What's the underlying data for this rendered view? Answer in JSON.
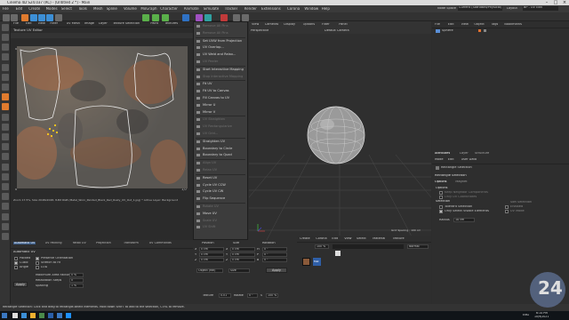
{
  "window": {
    "title": "Cinema 4D S24.037 (RC) - [Untitled 2 *] - Main",
    "layout_label": "Node Space",
    "layout_value": "Current (Standard/Physical)",
    "layout2_label": "Layout",
    "layout2_value": "BP - UV Edit"
  },
  "menubar": [
    "File",
    "Edit",
    "Create",
    "Modes",
    "Select",
    "Tools",
    "Mesh",
    "Spline",
    "Volume",
    "MoGraph",
    "Character",
    "Animate",
    "Simulate",
    "Tracker",
    "Render",
    "Extensions",
    "Corona",
    "Window",
    "Help"
  ],
  "texture_view": {
    "menus": [
      "File",
      "Edit",
      "View",
      "Filter",
      "UV Mesh",
      "Image",
      "Layer",
      "Texture Selection",
      "Paint",
      "Textures"
    ],
    "title": "Texture UV Editor",
    "status": "Zoom 17.5%, Size 2048x2048, 8-Bit RGB (Metal_Worn_Painted_Black_Red_Rusty_UV_Out_1.jpg) * Active Layer: Background",
    "axis_top_left": "0,0",
    "axis_bottom_left": "0",
    "axis_bottom_right": "1,0"
  },
  "context_menu": {
    "items": [
      {
        "label": "Remove All Pins",
        "enabled": false
      },
      {
        "label": "Remove All Pins",
        "enabled": false
      },
      {
        "label": "Set UVW from Projection",
        "enabled": true
      },
      {
        "label": "UV Overlap...",
        "enabled": true
      },
      {
        "label": "UV Weld and Relax...",
        "enabled": true
      },
      {
        "label": "UV Peeler",
        "enabled": false
      },
      {
        "label": "Start Interactive Mapping",
        "enabled": true
      },
      {
        "label": "Stop Interactive Mapping",
        "enabled": false
      },
      {
        "label": "Fit UV",
        "enabled": true
      },
      {
        "label": "Fit UV to Canvas",
        "enabled": true
      },
      {
        "label": "Fill Canvas to UV",
        "enabled": true
      },
      {
        "label": "Mirror U",
        "enabled": true
      },
      {
        "label": "Mirror V",
        "enabled": true
      },
      {
        "label": "UV Straighten",
        "enabled": false
      },
      {
        "label": "UV Rectangularize",
        "enabled": false
      },
      {
        "label": "UV Grid...",
        "enabled": false
      },
      {
        "label": "Straighten UV",
        "enabled": true
      },
      {
        "label": "Boundary to Circle",
        "enabled": true
      },
      {
        "label": "Boundary to Quad",
        "enabled": true
      },
      {
        "label": "Align UV",
        "enabled": false
      },
      {
        "label": "Relax UV",
        "enabled": false
      },
      {
        "label": "Reset UV",
        "enabled": true
      },
      {
        "label": "Cycle UV CCW",
        "enabled": true
      },
      {
        "label": "Cycle UV CW",
        "enabled": true
      },
      {
        "label": "Flip Sequence",
        "enabled": true
      },
      {
        "label": "Rotate UV",
        "enabled": false
      },
      {
        "label": "Move UV",
        "enabled": true
      },
      {
        "label": "Scale UV",
        "enabled": false
      },
      {
        "label": "UV Shift",
        "enabled": false
      }
    ]
  },
  "viewport": {
    "menus": [
      "View",
      "Cameras",
      "Display",
      "Options",
      "Filter",
      "Panel"
    ],
    "mode": "Perspective",
    "camera": "Default Camera",
    "grid_spacing": "Grid Spacing : 100 cm"
  },
  "object_manager": {
    "menus": [
      "File",
      "Edit",
      "View",
      "Object",
      "Tags",
      "Bookmarks"
    ],
    "objects": [
      "Sphere"
    ]
  },
  "attribute_manager": {
    "tabs": [
      "Attributes",
      "Layer",
      "Structure"
    ],
    "menus": [
      "Mode",
      "Edit",
      "User Data"
    ],
    "tool_name": "Rectangle Selection",
    "section_title": "Rectangle Selection",
    "subtabs": [
      "Options",
      "Magnet"
    ],
    "options_header": "Options",
    "fields": [
      {
        "label": "Keep Neighbor Components",
        "checked": false,
        "enabled": false
      },
      {
        "label": "Only UV Coordinates",
        "checked": false,
        "enabled": false
      }
    ],
    "selection_header": "Selection",
    "selection_left": [
      {
        "label": "Tolerant Selection",
        "checked": false
      },
      {
        "label": "Only Select Visible Elements",
        "checked": true
      }
    ],
    "selection_right": [
      {
        "label": "Soft Selection",
        "checked": false
      },
      {
        "label": "Enabled",
        "checked": false
      },
      {
        "label": "UV Mode",
        "checked": false
      }
    ],
    "radius_label": "Radius",
    "radius_value": "10 cm"
  },
  "uv_commands": {
    "tabs": [
      "Automatic UV",
      "UV Packing",
      "Relax UV",
      "Projection",
      "Transform",
      "UV Commands"
    ],
    "title": "Automatic UV",
    "options": [
      {
        "label": "Packed",
        "checked": false
      },
      {
        "label": "Cubic",
        "checked": true
      },
      {
        "label": "Angle",
        "checked": false
      }
    ],
    "right_options": [
      {
        "label": "Preserve Orientation",
        "checked": true
      },
      {
        "label": "Stretch to Fit",
        "checked": false
      },
      {
        "label": "LOD",
        "checked": false
      }
    ],
    "fields": [
      {
        "label": "Maximum Area Factor",
        "value": "0 %"
      },
      {
        "label": "Relaxation Steps",
        "value": "0"
      },
      {
        "label": "Spacing",
        "value": "1 %"
      }
    ],
    "apply": "Apply"
  },
  "coordinates": {
    "headers": [
      "Position",
      "Size",
      "Rotation"
    ],
    "rows": [
      {
        "axis": "X",
        "pos": "0 cm",
        "size": "0 cm",
        "rot_label": "H",
        "rot": "0 °"
      },
      {
        "axis": "Y",
        "pos": "0 cm",
        "size": "0 cm",
        "rot_label": "P",
        "rot": "0 °"
      },
      {
        "axis": "Z",
        "pos": "0 cm",
        "size": "0 cm",
        "rot_label": "B",
        "rot": "0 °"
      }
    ],
    "mode1": "Object (Rel)",
    "mode2": "Size",
    "apply": "Apply"
  },
  "material": {
    "menus": [
      "Create",
      "Corona",
      "Edit",
      "View",
      "Select",
      "Material",
      "Texture"
    ],
    "zoom": "100 %",
    "blend_mode": "Normal",
    "material_name": "Mat"
  },
  "transform_bar": {
    "texture_label": "Texture",
    "texture_value": "0.01",
    "rotate_label": "Rotate",
    "rotate_value": "0 °",
    "scale_label": "S",
    "scale_value": "100 %"
  },
  "status": "Rectangle Selection: Click and drag to rectangle-select elements. Hold down SHIFT to add to the selection, CTRL to remove.",
  "taskbar": {
    "time": "6:14 PM",
    "date": "10/9/2021",
    "lang": "ENG"
  },
  "watermark": "24",
  "colors": {
    "accent": "#4a90d9",
    "selected_menu": "#55565a",
    "uv_outline": "#e8e8e8",
    "rust": "#b56a3e"
  }
}
